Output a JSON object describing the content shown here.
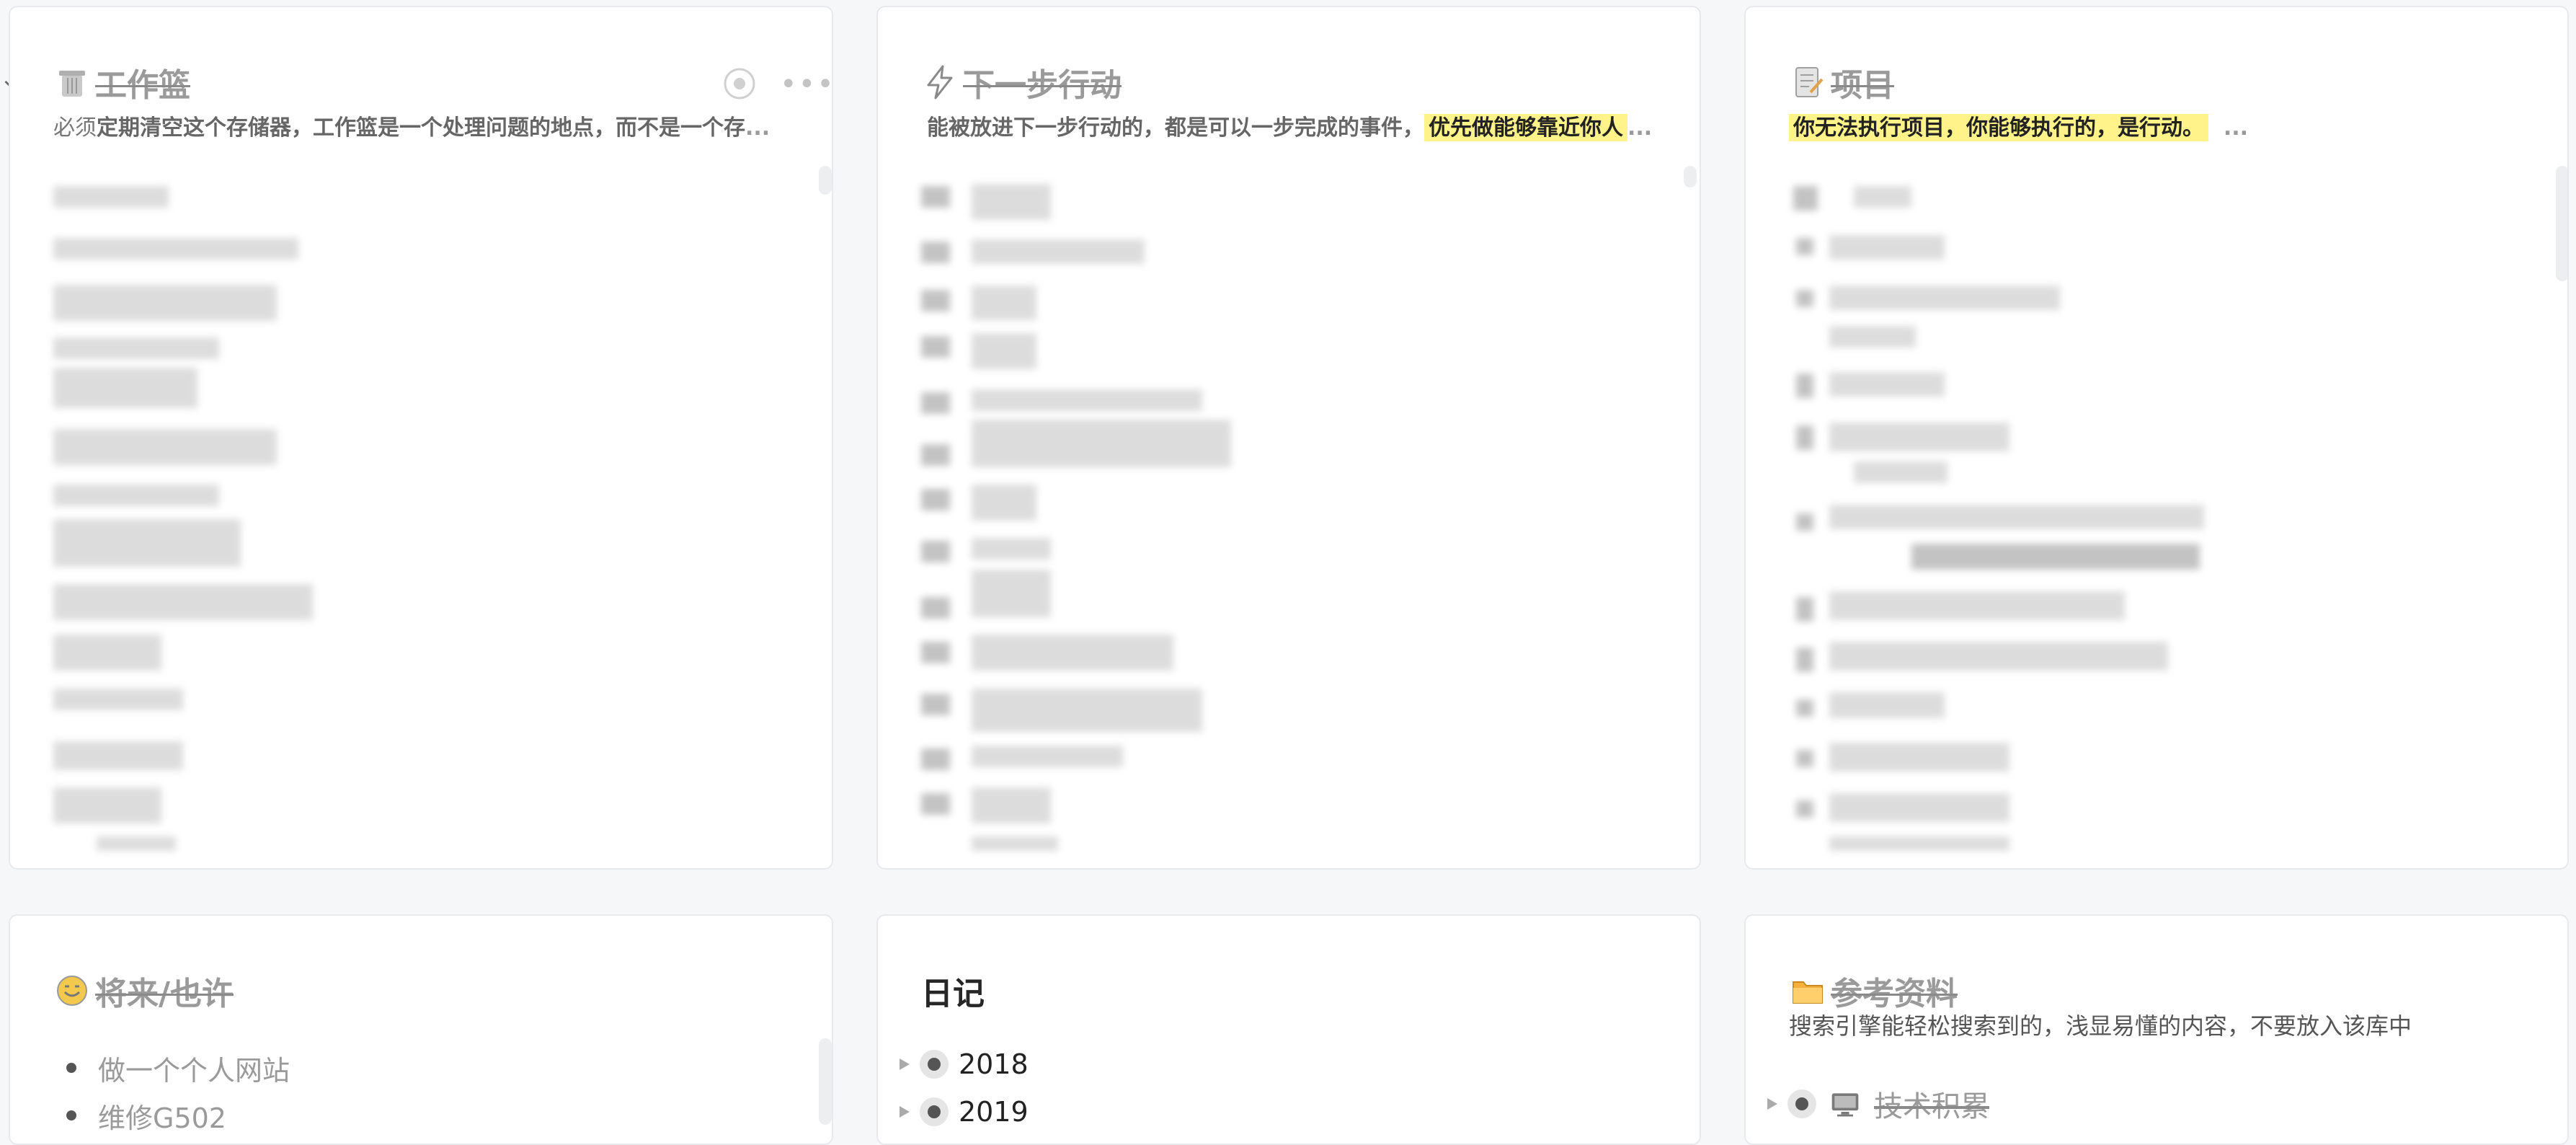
{
  "cards": {
    "inbox": {
      "title": "工作篮",
      "icon": "trash-basket-icon",
      "desc_pre": "必须",
      "desc_main": "定期清空这个存储器，工作篮是一个处理问题的地点，而不是一个存",
      "desc_ellipsis": "..."
    },
    "next_actions": {
      "title": "下一步行动",
      "icon": "lightning-icon",
      "desc_main": "能被放进下一步行动的，都是可以一步完成的事件，",
      "desc_highlight": "优先做能够靠近你人",
      "desc_ellipsis": "..."
    },
    "projects": {
      "title": "项目",
      "icon": "memo-icon",
      "desc_highlight": "你无法执行项目，你能够执行的，是行动。",
      "desc_ellipsis": "..."
    },
    "someday": {
      "title": "将来/也许",
      "icon": "smiley-icon",
      "items": [
        "做一个个人网站",
        "维修G502"
      ]
    },
    "diary": {
      "title": "日记",
      "years": [
        "2018",
        "2019"
      ]
    },
    "reference": {
      "title": "参考资料",
      "icon": "folder-icon",
      "desc": "搜索引擎能轻松搜索到的，浅显易懂的内容，不要放入该库中",
      "items": [
        "技术积累"
      ],
      "item_icon": "computer-icon"
    }
  },
  "colors": {
    "highlight": "#fff38a",
    "title_gray": "#9a9a9a",
    "card_border": "#e8e9ec",
    "background": "#f6f7f9"
  }
}
